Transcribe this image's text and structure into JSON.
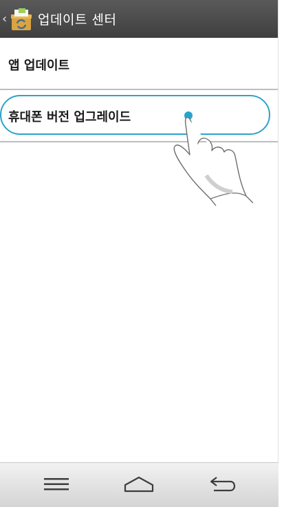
{
  "header": {
    "title": "업데이트 센터",
    "back_icon": "chevron-left-icon",
    "app_icon": "update-center-icon"
  },
  "list": {
    "items": [
      {
        "label": "앱 업데이트"
      },
      {
        "label": "휴대폰 버전 업그레이드"
      }
    ],
    "highlight_color": "#2aa3c9"
  },
  "navbar": {
    "menu_icon": "menu-icon",
    "home_icon": "home-icon",
    "back_icon": "back-arrow-icon"
  }
}
